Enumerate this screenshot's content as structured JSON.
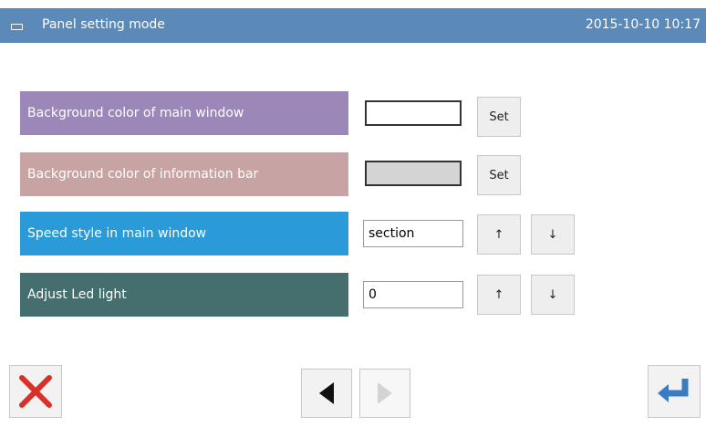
{
  "title_bar": {
    "title": "Panel setting mode",
    "datetime": "2015-10-10 10:17",
    "menu_icon": "window-menu-icon"
  },
  "settings": [
    {
      "label": "Background color of main window",
      "label_color": "#9b87b8",
      "control": "color",
      "swatch_color": "#ffffff",
      "button": "Set"
    },
    {
      "label": "Background color of information bar",
      "label_color": "#c8a3a3",
      "control": "color",
      "swatch_color": "#d4d4d4",
      "button": "Set"
    },
    {
      "label": "Speed style in main window",
      "label_color": "#2b9ad8",
      "control": "value",
      "value": "section",
      "up": "↑",
      "down": "↓"
    },
    {
      "label": "Adjust Led light",
      "label_color": "#446f6e",
      "control": "value",
      "value": "0",
      "up": "↑",
      "down": "↓"
    }
  ],
  "bottom_bar": {
    "close_icon": "close-x-icon",
    "prev_icon": "triangle-left-icon",
    "next_icon": "triangle-right-icon",
    "enter_icon": "enter-return-icon"
  },
  "colors": {
    "title_bar": "#5b8ab8",
    "close": "#d8312c",
    "enter": "#3a7cc4"
  }
}
